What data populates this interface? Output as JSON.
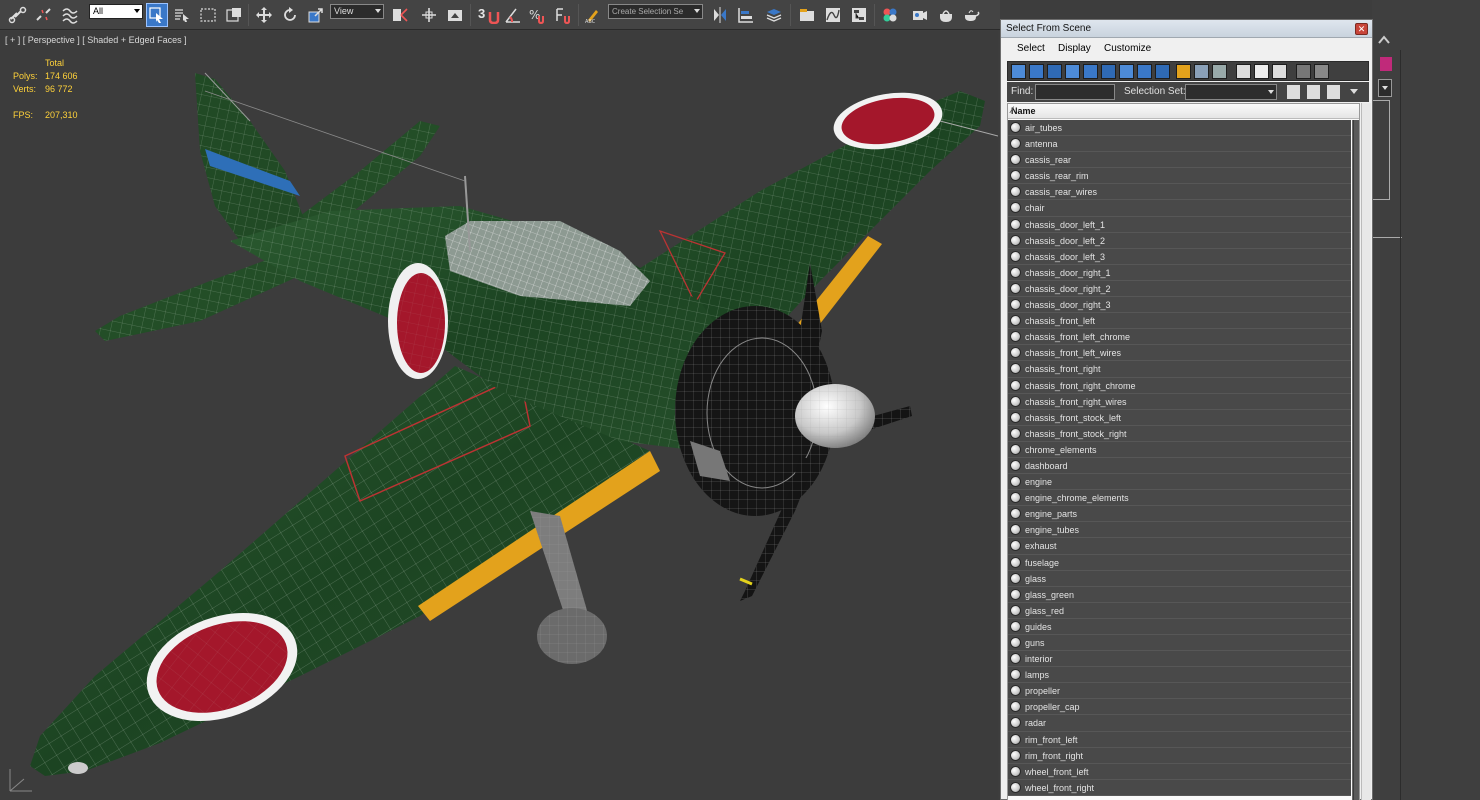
{
  "toolbar": {
    "filter_value": "All",
    "ref_coord_value": "View",
    "snap_label": "3",
    "named_selection_placeholder": "Create Selection Se"
  },
  "viewport": {
    "label": "[ + ] [ Perspective ] [ Shaded + Edged Faces ]",
    "stats": {
      "total_label": "Total",
      "polys_label": "Polys:",
      "polys_value": "174 606",
      "verts_label": "Verts:",
      "verts_value": "96 772",
      "fps_label": "FPS:",
      "fps_value": "207,310"
    }
  },
  "dialog": {
    "title": "Select From Scene",
    "menu": [
      "Select",
      "Display",
      "Customize"
    ],
    "find_label": "Find:",
    "find_value": "",
    "selection_set_label": "Selection Set:",
    "column_header": "Name",
    "items": [
      "air_tubes",
      "antenna",
      "cassis_rear",
      "cassis_rear_rim",
      "cassis_rear_wires",
      "chair",
      "chassis_door_left_1",
      "chassis_door_left_2",
      "chassis_door_left_3",
      "chassis_door_right_1",
      "chassis_door_right_2",
      "chassis_door_right_3",
      "chassis_front_left",
      "chassis_front_left_chrome",
      "chassis_front_left_wires",
      "chassis_front_right",
      "chassis_front_right_chrome",
      "chassis_front_right_wires",
      "chassis_front_stock_left",
      "chassis_front_stock_right",
      "chrome_elements",
      "dashboard",
      "engine",
      "engine_chrome_elements",
      "engine_parts",
      "engine_tubes",
      "exhaust",
      "fuselage",
      "glass",
      "glass_green",
      "glass_red",
      "guides",
      "guns",
      "interior",
      "lamps",
      "propeller",
      "propeller_cap",
      "radar",
      "rim_front_left",
      "rim_front_right",
      "wheel_front_left",
      "wheel_front_right"
    ]
  },
  "colors": {
    "accent": "#3a78c8",
    "stats_text": "#ffd23a",
    "aircraft_green": "#1f4a25",
    "hinomaru_red": "#a4172b",
    "leading_edge_yellow": "#e3a21c"
  }
}
